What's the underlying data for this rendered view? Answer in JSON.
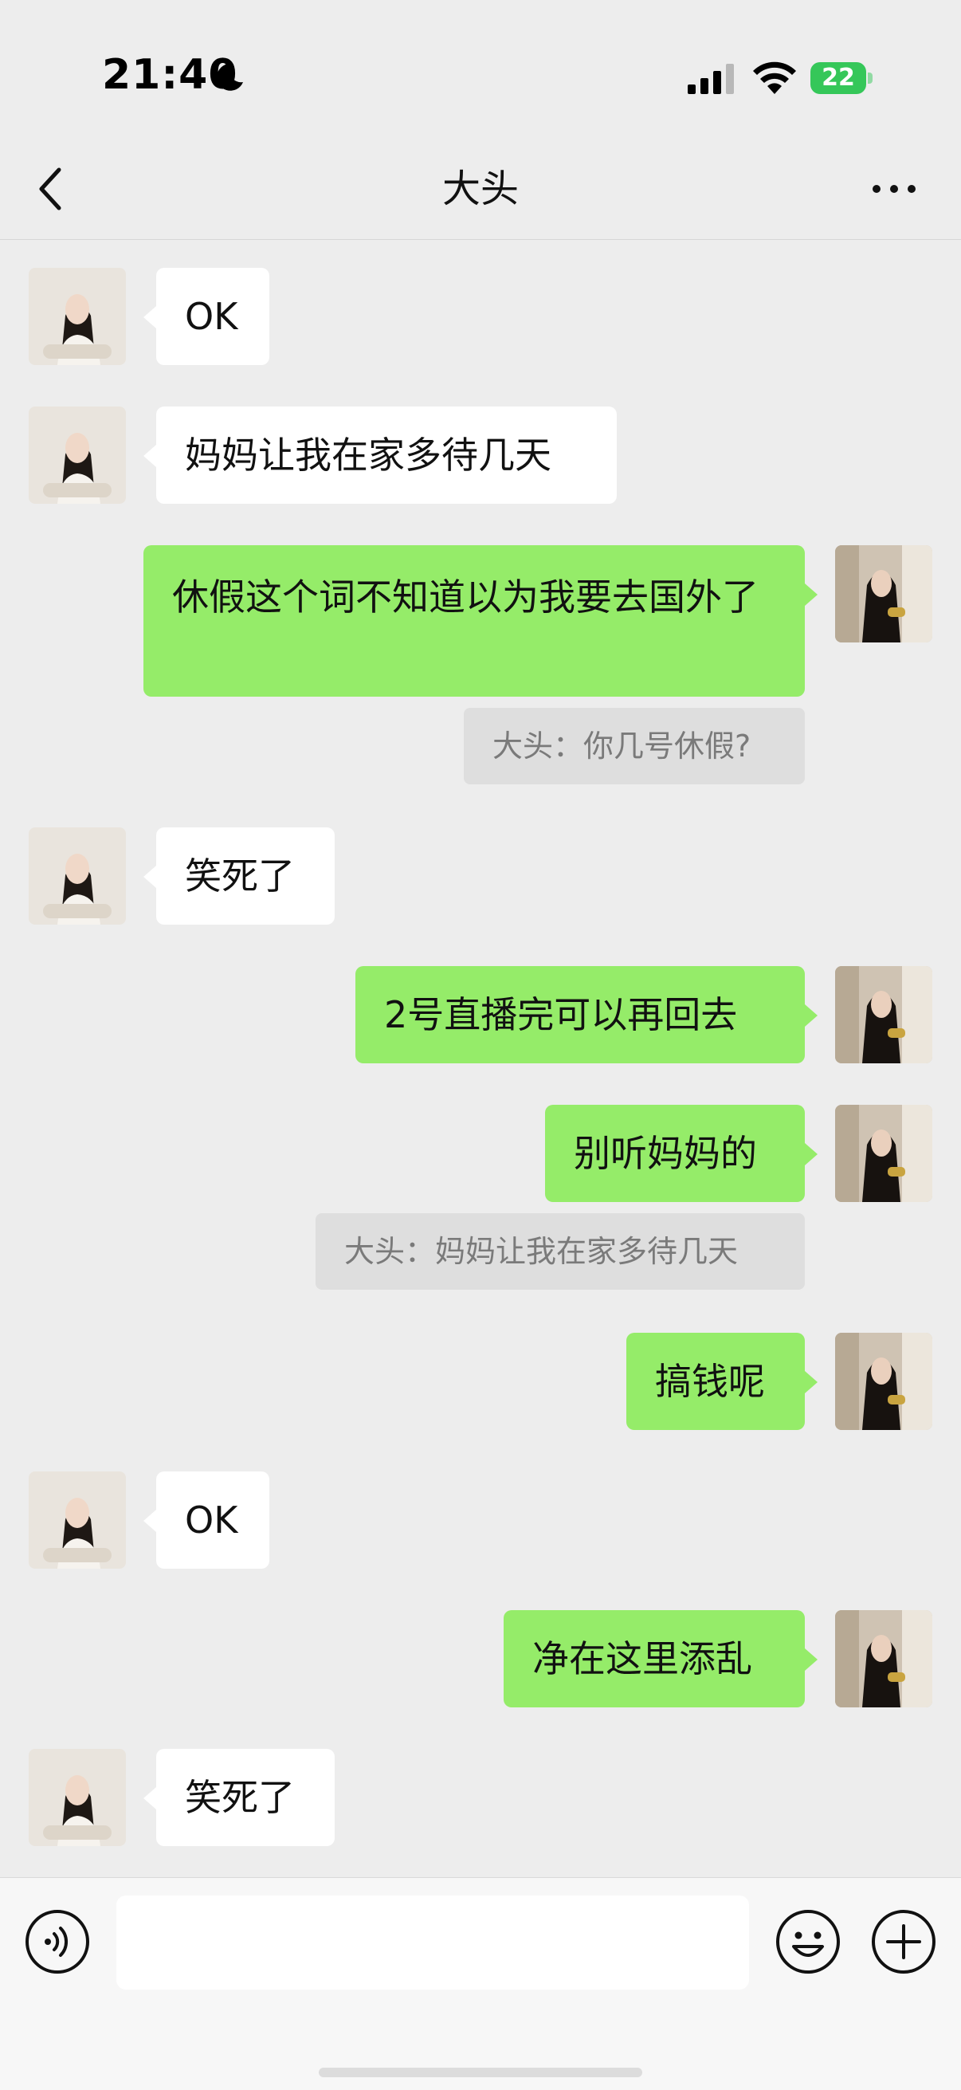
{
  "status_bar": {
    "time": "21:40",
    "battery": "22"
  },
  "nav": {
    "title": "大头"
  },
  "messages": [
    {
      "text": "OK",
      "direction": "incoming"
    },
    {
      "text": "妈妈让我在家多待几天",
      "direction": "incoming"
    },
    {
      "text": "休假这个词不知道以为我要去国外了",
      "direction": "outgoing",
      "quote": "大头：你几号休假?"
    },
    {
      "text": "笑死了",
      "direction": "incoming"
    },
    {
      "text": "2号直播完可以再回去",
      "direction": "outgoing"
    },
    {
      "text": "别听妈妈的",
      "direction": "outgoing",
      "quote": "大头：妈妈让我在家多待几天"
    },
    {
      "text": "搞钱呢",
      "direction": "outgoing"
    },
    {
      "text": "OK",
      "direction": "incoming"
    },
    {
      "text": "净在这里添乱",
      "direction": "outgoing"
    },
    {
      "text": "笑死了",
      "direction": "incoming"
    }
  ],
  "input": {
    "value": "",
    "placeholder": ""
  },
  "colors": {
    "outgoing_bubble": "#95ec69",
    "incoming_bubble": "#ffffff",
    "background": "#ededed"
  }
}
